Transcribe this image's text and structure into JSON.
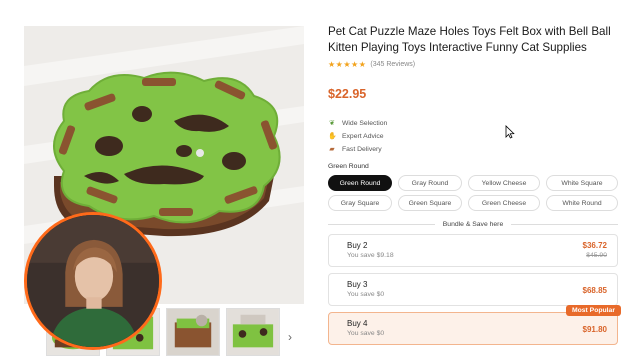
{
  "product": {
    "title": "Pet Cat Puzzle Maze Holes Toys Felt Box with Bell Ball Kitten Playing Toys Interactive Funny Cat Supplies",
    "stars": "★★★★★",
    "reviews": "(345 Reviews)",
    "price": "$22.95"
  },
  "features": [
    {
      "icon": "leaf-icon",
      "glyph": "❦",
      "label": "Wide Selection"
    },
    {
      "icon": "hand-icon",
      "glyph": "✋",
      "label": "Expert Advice"
    },
    {
      "icon": "truck-icon",
      "glyph": "▰",
      "label": "Fast Delivery"
    }
  ],
  "variant": {
    "selected_label": "Green Round",
    "options": [
      "Green Round",
      "Gray Round",
      "Yellow Cheese",
      "White Square",
      "Gray Square",
      "Green Square",
      "Green Cheese",
      "White Round"
    ]
  },
  "bundle": {
    "heading": "Bundle & Save here",
    "options": [
      {
        "name": "Buy 2",
        "save": "You save $9.18",
        "price": "$36.72",
        "old_price": "$45.90"
      },
      {
        "name": "Buy 3",
        "save": "You save $0",
        "price": "$68.85",
        "old_price": ""
      },
      {
        "name": "Buy 4",
        "save": "You save $0",
        "price": "$91.80",
        "old_price": "",
        "badge": "Most Popular"
      }
    ]
  },
  "gallery": {
    "next_glyph": "›"
  },
  "colors": {
    "accent": "#d9642a",
    "selected_chip": "#111111",
    "felt_green": "#7fc241",
    "wood_brown": "#6b3d22",
    "webcam_ring": "#ff6a1a"
  }
}
